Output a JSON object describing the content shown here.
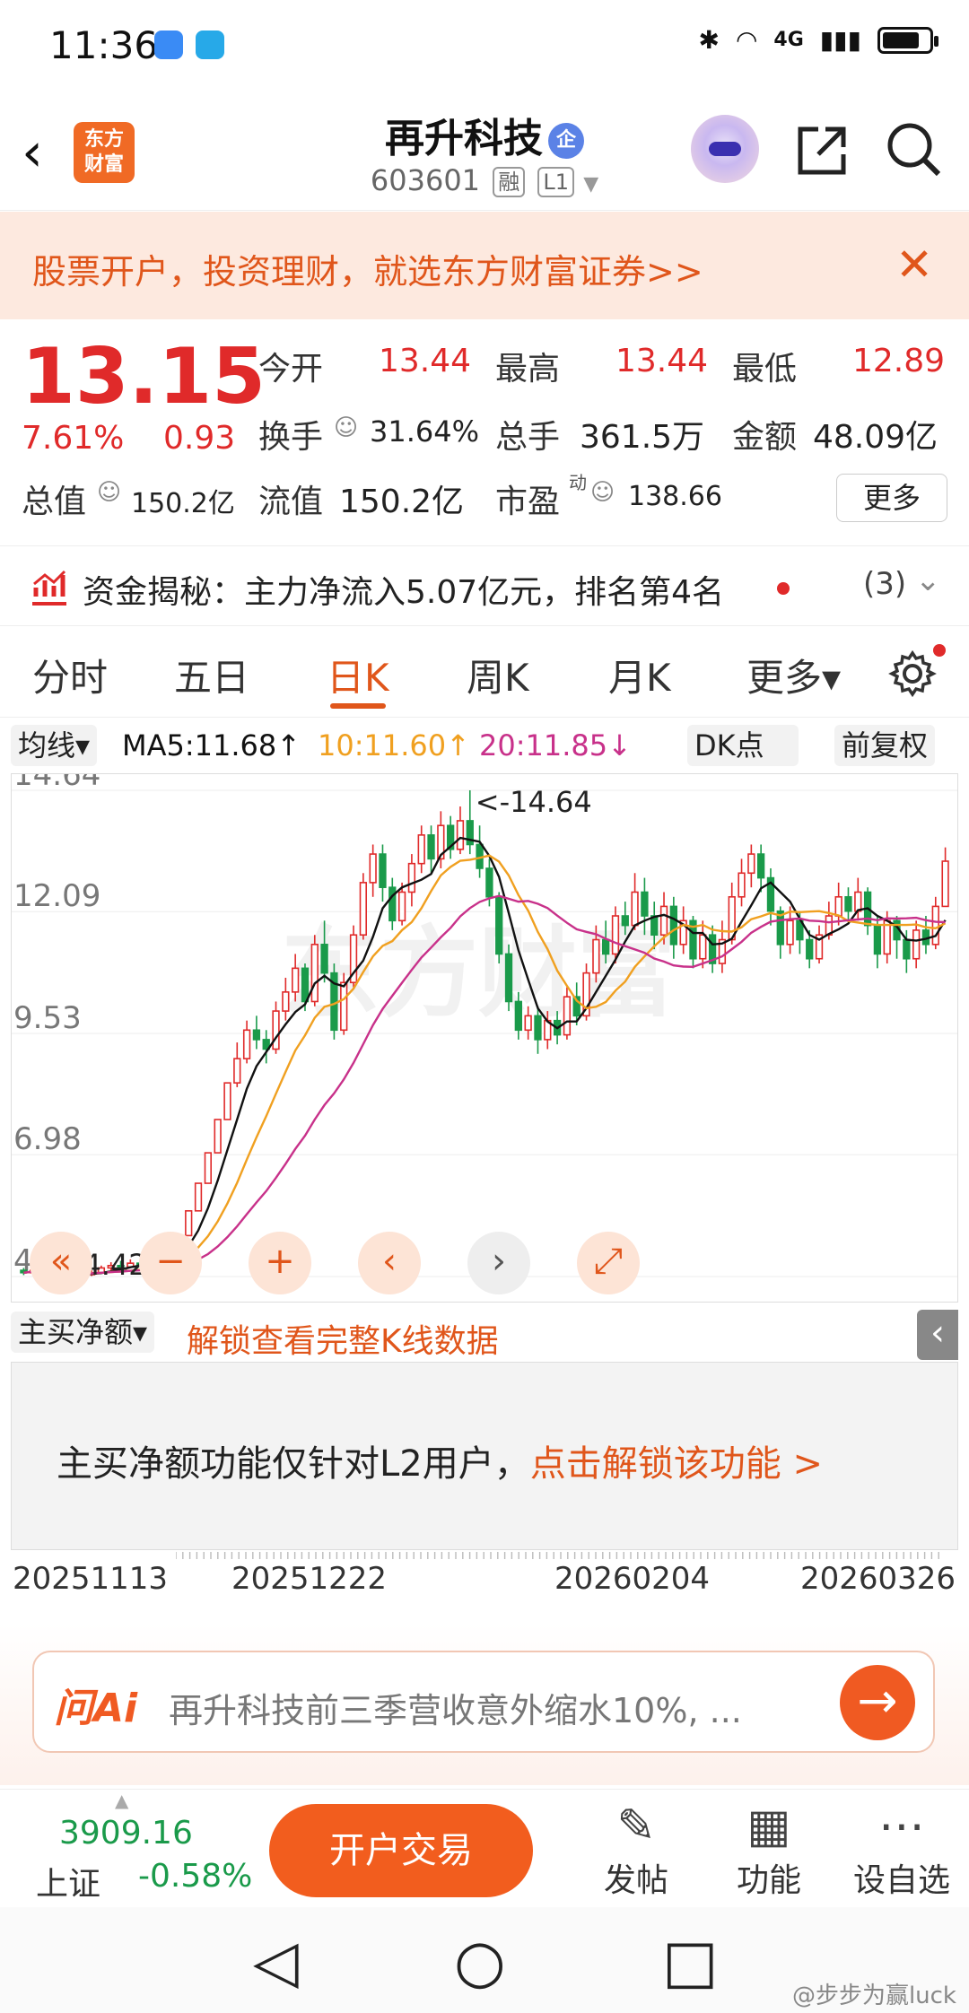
{
  "status_bar": {
    "time": "11:36",
    "network": "4G"
  },
  "header": {
    "logo_text": "东方\n财富",
    "stock_name": "再升科技",
    "qi_badge": "企",
    "stock_code": "603601",
    "tag_rong": "融",
    "tag_level": "L1"
  },
  "banner": {
    "text": "股票开户，投资理财，就选东方财富证券>>"
  },
  "quote": {
    "price": "13.15",
    "change_pct": "7.61%",
    "change_abs": "0.93",
    "open_label": "今开",
    "open_value": "13.44",
    "high_label": "最高",
    "high_value": "13.44",
    "low_label": "最低",
    "low_value": "12.89",
    "turnover_label": "换手",
    "turnover_value": "31.64%",
    "volume_label": "总手",
    "volume_value": "361.5万",
    "amount_label": "金额",
    "amount_value": "48.09亿",
    "mcap_label": "总值",
    "mcap_value": "150.2亿",
    "float_label": "流值",
    "float_value": "150.2亿",
    "pe_label": "市盈",
    "pe_sup": "动",
    "pe_value": "138.66",
    "more_label": "更多"
  },
  "fund_flow": {
    "text": "资金揭秘：主力净流入5.07亿元，排名第4名",
    "count": "(3)"
  },
  "tabs": [
    {
      "label": "分时"
    },
    {
      "label": "五日"
    },
    {
      "label": "日K"
    },
    {
      "label": "周K"
    },
    {
      "label": "月K"
    },
    {
      "label": "更多▾"
    }
  ],
  "ma_line": {
    "selector": "均线▾",
    "ma5": "MA5:11.68↑",
    "ma10": "10:11.60↑",
    "ma20": "20:11.85↓",
    "dk": "DK点",
    "adjust": "前复权"
  },
  "colors": {
    "up": "#e02a2a",
    "down": "#1a9a4a",
    "ma5": "#111111",
    "ma10": "#f0a020",
    "ma20": "#c8318a",
    "accent": "#f05a22"
  },
  "chart_data": {
    "type": "candlestick",
    "y_tick_labels": [
      "14.64",
      "12.09",
      "9.53",
      "6.98",
      "4.42"
    ],
    "ylim": [
      4.42,
      14.64
    ],
    "max_annotation": "<-14.64",
    "min_annotation": "<-4.42",
    "x_tick_labels": [
      "20251113",
      "20251222",
      "20260204",
      "20260326"
    ],
    "watermark": "东方财富",
    "candles": [
      {
        "o": 4.55,
        "c": 4.5,
        "h": 4.6,
        "l": 4.45
      },
      {
        "o": 4.5,
        "c": 4.55,
        "h": 4.6,
        "l": 4.45
      },
      {
        "o": 4.55,
        "c": 4.48,
        "h": 4.6,
        "l": 4.42
      },
      {
        "o": 4.48,
        "c": 4.5,
        "h": 4.55,
        "l": 4.42
      },
      {
        "o": 4.5,
        "c": 4.46,
        "h": 4.55,
        "l": 4.42
      },
      {
        "o": 4.46,
        "c": 4.44,
        "h": 4.5,
        "l": 4.42
      },
      {
        "o": 4.44,
        "c": 4.46,
        "h": 4.52,
        "l": 4.42
      },
      {
        "o": 4.46,
        "c": 4.5,
        "h": 4.55,
        "l": 4.43
      },
      {
        "o": 4.5,
        "c": 4.6,
        "h": 4.65,
        "l": 4.48
      },
      {
        "o": 4.6,
        "c": 4.65,
        "h": 4.72,
        "l": 4.55
      },
      {
        "o": 4.65,
        "c": 4.62,
        "h": 4.75,
        "l": 4.58
      },
      {
        "o": 4.62,
        "c": 4.7,
        "h": 4.78,
        "l": 4.6
      },
      {
        "o": 4.7,
        "c": 4.68,
        "h": 4.76,
        "l": 4.62
      },
      {
        "o": 4.68,
        "c": 4.72,
        "h": 4.8,
        "l": 4.65
      },
      {
        "o": 4.72,
        "c": 4.69,
        "h": 4.78,
        "l": 4.64
      },
      {
        "o": 4.69,
        "c": 4.8,
        "h": 4.86,
        "l": 4.68
      },
      {
        "o": 4.8,
        "c": 5.28,
        "h": 5.28,
        "l": 4.8
      },
      {
        "o": 5.28,
        "c": 5.8,
        "h": 5.8,
        "l": 5.28
      },
      {
        "o": 5.8,
        "c": 6.38,
        "h": 6.38,
        "l": 5.8
      },
      {
        "o": 6.38,
        "c": 7.02,
        "h": 7.02,
        "l": 6.38
      },
      {
        "o": 7.02,
        "c": 7.72,
        "h": 7.72,
        "l": 7.02
      },
      {
        "o": 7.72,
        "c": 8.49,
        "h": 8.49,
        "l": 7.72
      },
      {
        "o": 8.49,
        "c": 9.0,
        "h": 9.34,
        "l": 8.4
      },
      {
        "o": 9.0,
        "c": 9.6,
        "h": 9.8,
        "l": 8.9
      },
      {
        "o": 9.6,
        "c": 9.4,
        "h": 9.9,
        "l": 9.2
      },
      {
        "o": 9.4,
        "c": 9.2,
        "h": 9.6,
        "l": 8.9
      },
      {
        "o": 9.2,
        "c": 10.0,
        "h": 10.2,
        "l": 9.1
      },
      {
        "o": 10.0,
        "c": 10.4,
        "h": 10.7,
        "l": 9.8
      },
      {
        "o": 10.4,
        "c": 10.9,
        "h": 11.2,
        "l": 10.2
      },
      {
        "o": 10.9,
        "c": 10.2,
        "h": 11.0,
        "l": 10.0
      },
      {
        "o": 10.2,
        "c": 11.4,
        "h": 11.6,
        "l": 10.1
      },
      {
        "o": 11.4,
        "c": 10.8,
        "h": 11.9,
        "l": 10.6
      },
      {
        "o": 10.8,
        "c": 9.6,
        "h": 11.0,
        "l": 9.4
      },
      {
        "o": 9.6,
        "c": 10.6,
        "h": 10.8,
        "l": 9.5
      },
      {
        "o": 10.6,
        "c": 11.6,
        "h": 11.8,
        "l": 10.5
      },
      {
        "o": 11.6,
        "c": 12.7,
        "h": 12.9,
        "l": 11.5
      },
      {
        "o": 12.7,
        "c": 13.3,
        "h": 13.5,
        "l": 12.4
      },
      {
        "o": 13.3,
        "c": 12.6,
        "h": 13.5,
        "l": 12.3
      },
      {
        "o": 12.6,
        "c": 11.9,
        "h": 12.8,
        "l": 11.7
      },
      {
        "o": 11.9,
        "c": 12.5,
        "h": 12.7,
        "l": 11.8
      },
      {
        "o": 12.5,
        "c": 13.1,
        "h": 13.3,
        "l": 12.2
      },
      {
        "o": 13.1,
        "c": 13.7,
        "h": 13.9,
        "l": 12.9
      },
      {
        "o": 13.7,
        "c": 13.2,
        "h": 13.9,
        "l": 12.9
      },
      {
        "o": 13.2,
        "c": 13.9,
        "h": 14.2,
        "l": 13.0
      },
      {
        "o": 13.9,
        "c": 13.4,
        "h": 14.1,
        "l": 13.2
      },
      {
        "o": 13.4,
        "c": 14.0,
        "h": 14.3,
        "l": 13.3
      },
      {
        "o": 14.0,
        "c": 13.5,
        "h": 14.64,
        "l": 13.3
      },
      {
        "o": 13.5,
        "c": 13.0,
        "h": 13.9,
        "l": 12.8
      },
      {
        "o": 13.0,
        "c": 12.4,
        "h": 13.2,
        "l": 12.2
      },
      {
        "o": 12.4,
        "c": 11.2,
        "h": 12.5,
        "l": 11.0
      },
      {
        "o": 11.2,
        "c": 10.2,
        "h": 11.4,
        "l": 10.0
      },
      {
        "o": 10.2,
        "c": 9.6,
        "h": 10.4,
        "l": 9.4
      },
      {
        "o": 9.6,
        "c": 9.9,
        "h": 10.1,
        "l": 9.4
      },
      {
        "o": 9.9,
        "c": 9.4,
        "h": 10.1,
        "l": 9.1
      },
      {
        "o": 9.4,
        "c": 9.8,
        "h": 10.0,
        "l": 9.2
      },
      {
        "o": 9.8,
        "c": 9.5,
        "h": 10.0,
        "l": 9.3
      },
      {
        "o": 9.5,
        "c": 10.3,
        "h": 10.5,
        "l": 9.4
      },
      {
        "o": 10.3,
        "c": 9.9,
        "h": 10.6,
        "l": 9.7
      },
      {
        "o": 9.9,
        "c": 10.8,
        "h": 11.0,
        "l": 9.8
      },
      {
        "o": 10.8,
        "c": 11.5,
        "h": 11.8,
        "l": 10.6
      },
      {
        "o": 11.5,
        "c": 11.2,
        "h": 11.9,
        "l": 11.0
      },
      {
        "o": 11.2,
        "c": 12.0,
        "h": 12.2,
        "l": 11.0
      },
      {
        "o": 12.0,
        "c": 11.8,
        "h": 12.3,
        "l": 11.6
      },
      {
        "o": 11.8,
        "c": 12.5,
        "h": 12.9,
        "l": 11.7
      },
      {
        "o": 12.5,
        "c": 12.0,
        "h": 12.8,
        "l": 11.6
      },
      {
        "o": 12.0,
        "c": 11.6,
        "h": 12.3,
        "l": 11.3
      },
      {
        "o": 11.6,
        "c": 12.2,
        "h": 12.5,
        "l": 11.4
      },
      {
        "o": 12.2,
        "c": 11.4,
        "h": 12.4,
        "l": 11.1
      },
      {
        "o": 11.4,
        "c": 11.9,
        "h": 12.2,
        "l": 11.2
      },
      {
        "o": 11.9,
        "c": 11.1,
        "h": 12.0,
        "l": 10.9
      },
      {
        "o": 11.1,
        "c": 11.6,
        "h": 11.9,
        "l": 10.9
      },
      {
        "o": 11.6,
        "c": 11.0,
        "h": 11.8,
        "l": 10.8
      },
      {
        "o": 11.0,
        "c": 11.5,
        "h": 11.9,
        "l": 10.8
      },
      {
        "o": 11.5,
        "c": 12.4,
        "h": 12.7,
        "l": 11.4
      },
      {
        "o": 12.4,
        "c": 12.9,
        "h": 13.2,
        "l": 12.2
      },
      {
        "o": 12.9,
        "c": 13.3,
        "h": 13.5,
        "l": 12.6
      },
      {
        "o": 13.3,
        "c": 12.8,
        "h": 13.5,
        "l": 12.5
      },
      {
        "o": 12.8,
        "c": 12.1,
        "h": 13.0,
        "l": 11.8
      },
      {
        "o": 12.1,
        "c": 11.4,
        "h": 12.2,
        "l": 11.1
      },
      {
        "o": 11.4,
        "c": 11.9,
        "h": 12.2,
        "l": 11.2
      },
      {
        "o": 11.9,
        "c": 11.5,
        "h": 12.1,
        "l": 11.2
      },
      {
        "o": 11.5,
        "c": 11.1,
        "h": 11.7,
        "l": 10.9
      },
      {
        "o": 11.1,
        "c": 11.6,
        "h": 11.8,
        "l": 11.0
      },
      {
        "o": 11.6,
        "c": 12.0,
        "h": 12.3,
        "l": 11.5
      },
      {
        "o": 12.0,
        "c": 12.4,
        "h": 12.7,
        "l": 11.8
      },
      {
        "o": 12.4,
        "c": 12.1,
        "h": 12.6,
        "l": 11.9
      },
      {
        "o": 12.1,
        "c": 12.5,
        "h": 12.8,
        "l": 11.9
      },
      {
        "o": 12.5,
        "c": 11.8,
        "h": 12.6,
        "l": 11.6
      },
      {
        "o": 11.8,
        "c": 11.2,
        "h": 12.0,
        "l": 10.9
      },
      {
        "o": 11.2,
        "c": 11.9,
        "h": 12.1,
        "l": 11.0
      },
      {
        "o": 11.9,
        "c": 11.5,
        "h": 12.0,
        "l": 11.1
      },
      {
        "o": 11.5,
        "c": 11.1,
        "h": 11.7,
        "l": 10.8
      },
      {
        "o": 11.1,
        "c": 11.7,
        "h": 11.9,
        "l": 10.9
      },
      {
        "o": 11.7,
        "c": 11.4,
        "h": 12.0,
        "l": 11.2
      },
      {
        "o": 11.4,
        "c": 12.2,
        "h": 12.4,
        "l": 11.3
      },
      {
        "o": 12.2,
        "c": 13.15,
        "h": 13.44,
        "l": 12.89
      }
    ]
  },
  "chart_controls": [
    "«",
    "−",
    "+",
    "‹",
    "›",
    "⤢"
  ],
  "sub_chart": {
    "selector": "主买净额▾",
    "unlock_text": "解锁查看完整K线数据",
    "message": "主买净额功能仅针对L2用户，",
    "message_link": "点击解锁该功能 >"
  },
  "ai_box": {
    "brand": "问Ai",
    "question": "再升科技前三季营收意外缩水10%, ..."
  },
  "bottom_bar": {
    "index_value": "3909.16",
    "index_name": "上证",
    "index_change": "-0.58%",
    "trade_button": "开户交易",
    "post_label": "发帖",
    "func_label": "功能",
    "watch_label": "设自选"
  },
  "watermark_user": "@步步为赢luck"
}
